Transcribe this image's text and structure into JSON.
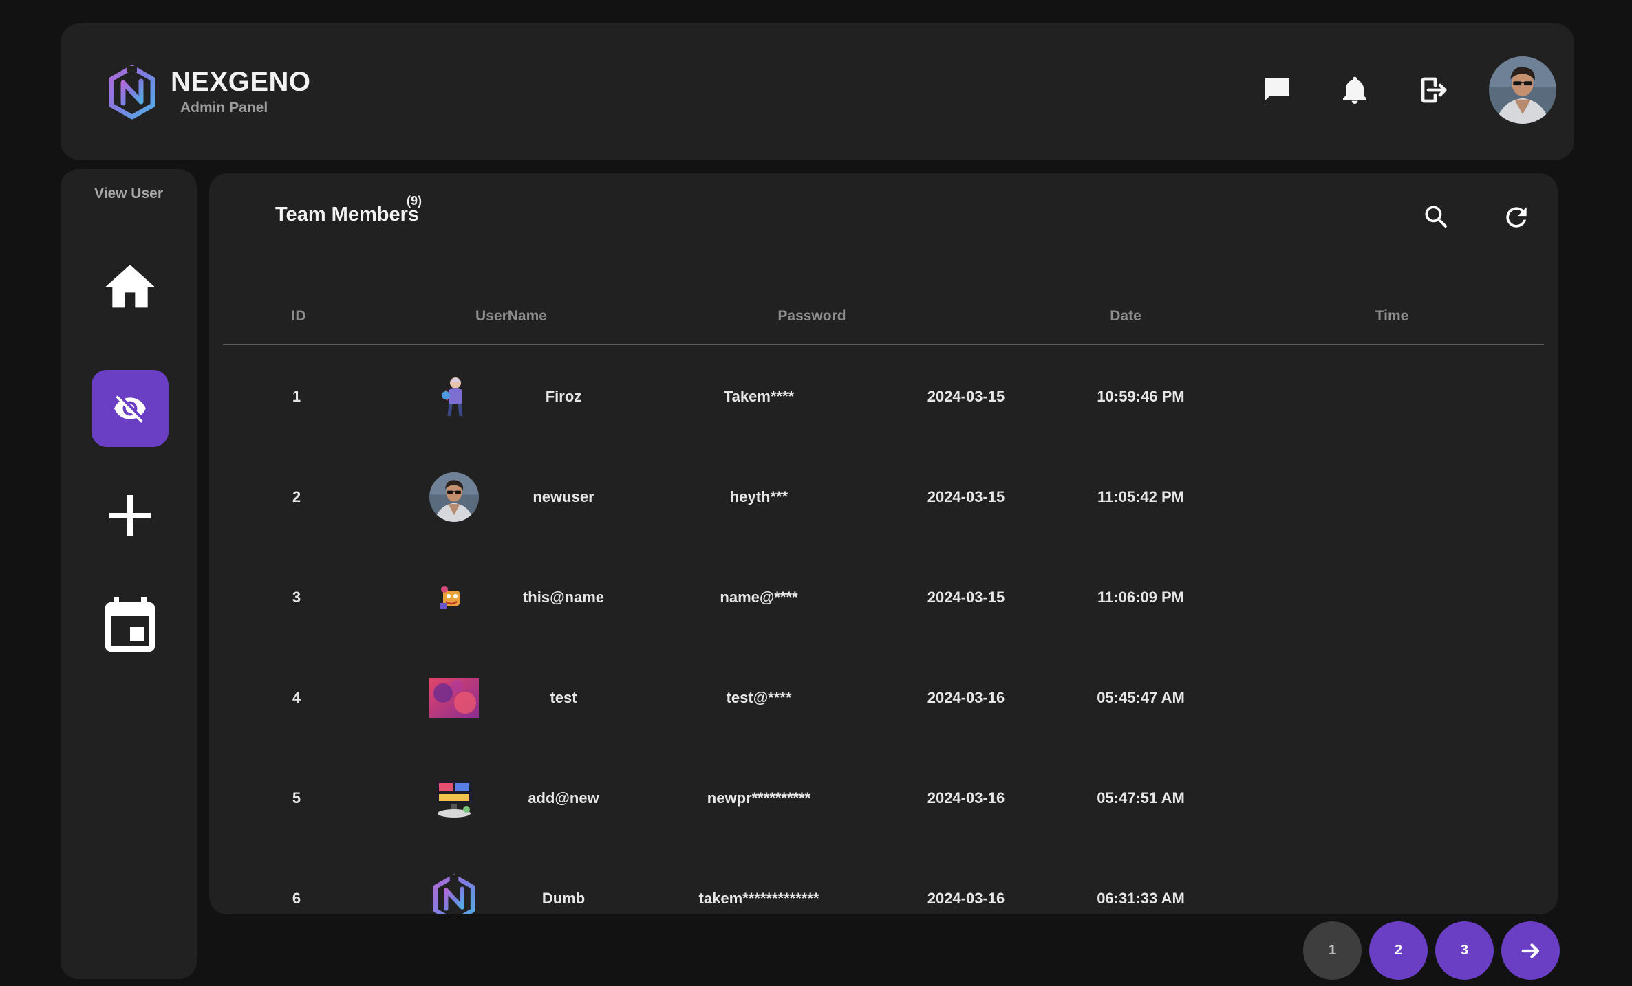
{
  "brand": {
    "name": "NEXGENO",
    "subtitle": "Admin Panel",
    "colors": {
      "gradient_start": "#9d6bd9",
      "gradient_end": "#4fa3e0"
    }
  },
  "header": {
    "icons": [
      "chat-icon",
      "bell-icon",
      "logout-icon",
      "profile-avatar"
    ]
  },
  "sidebar": {
    "title": "View User",
    "items": [
      {
        "icon": "home-icon"
      },
      {
        "icon": "eye-off-icon",
        "active": true
      },
      {
        "icon": "plus-icon"
      },
      {
        "icon": "calendar-icon"
      }
    ],
    "accent": "#6a3fc4"
  },
  "main": {
    "title": "Team Members",
    "count": "(9)",
    "tools": [
      "search-icon",
      "refresh-icon"
    ]
  },
  "table": {
    "columns": [
      "ID",
      "UserName",
      "Password",
      "Date",
      "Time"
    ],
    "rows": [
      {
        "id": "1",
        "username": "Firoz",
        "password": "Takem****",
        "date": "2024-03-15",
        "time": "10:59:46 PM",
        "avatar": "cartoon-figure"
      },
      {
        "id": "2",
        "username": "newuser",
        "password": "heyth***",
        "date": "2024-03-15",
        "time": "11:05:42 PM",
        "avatar": "person-photo"
      },
      {
        "id": "3",
        "username": "this@name",
        "password": "name@****",
        "date": "2024-03-15",
        "time": "11:06:09 PM",
        "avatar": "small-cartoon"
      },
      {
        "id": "4",
        "username": "test",
        "password": "test@****",
        "date": "2024-03-16",
        "time": "05:45:47 AM",
        "avatar": "abstract-pink"
      },
      {
        "id": "5",
        "username": "add@new",
        "password": "newpr**********",
        "date": "2024-03-16",
        "time": "05:47:51 AM",
        "avatar": "desk-illustration"
      },
      {
        "id": "6",
        "username": "Dumb",
        "password": "takem*************",
        "date": "2024-03-16",
        "time": "06:31:33 AM",
        "avatar": "nexgeno-logo"
      }
    ]
  },
  "pagination": {
    "pages": [
      "1",
      "2",
      "3"
    ],
    "current": "1",
    "next_icon": "arrow-right-icon"
  }
}
